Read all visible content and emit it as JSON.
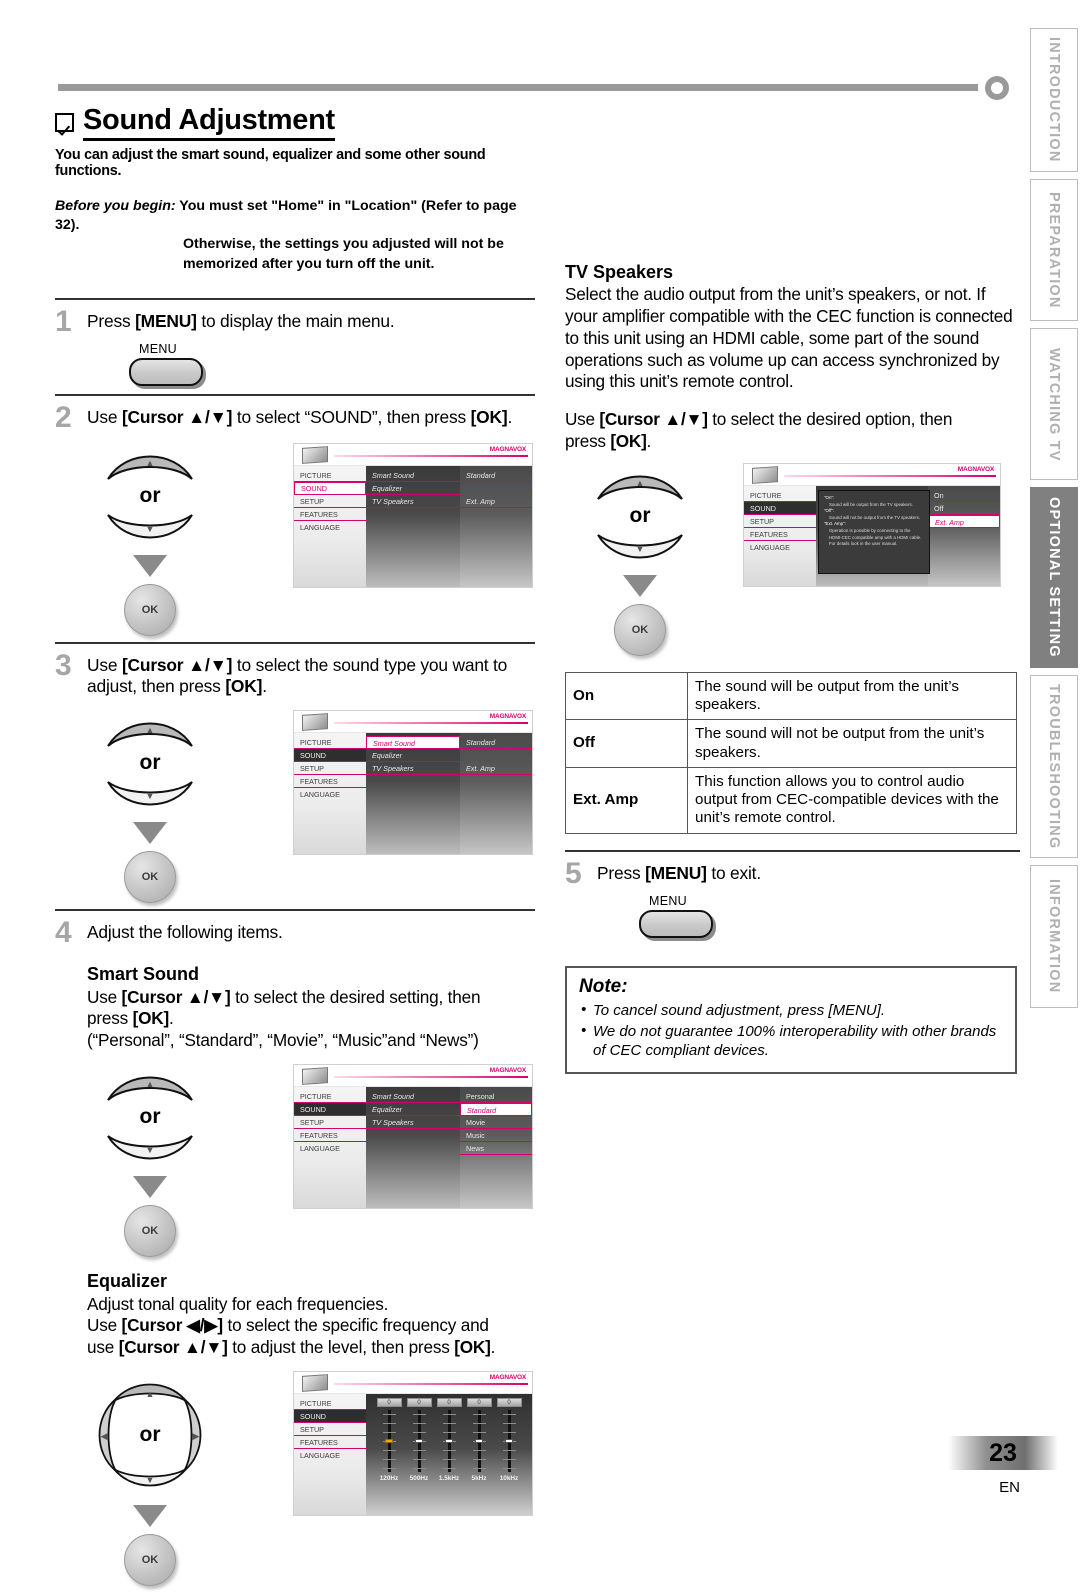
{
  "page": {
    "number": "23",
    "lang": "EN"
  },
  "tabs": [
    {
      "label": "INTRODUCTION",
      "active": false
    },
    {
      "label": "PREPARATION",
      "active": false
    },
    {
      "label": "WATCHING TV",
      "active": false
    },
    {
      "label": "OPTIONAL SETTING",
      "active": true
    },
    {
      "label": "TROUBLESHOOTING",
      "active": false
    },
    {
      "label": "INFORMATION",
      "active": false
    }
  ],
  "heading": {
    "title": "Sound Adjustment",
    "intro": "You can adjust the smart sound, equalizer and some other sound functions.",
    "before_label": "Before you begin:",
    "before_line1": "You must set \"Home\" in \"Location\" (Refer to page 32).",
    "before_line2": "Otherwise, the settings you adjusted will not be",
    "before_line3": "memorized after you turn off the unit."
  },
  "steps": {
    "s1": {
      "num": "1",
      "text_a": "Press ",
      "text_b": "[MENU]",
      "text_c": " to display the main menu.",
      "button_label": "MENU"
    },
    "s2": {
      "num": "2",
      "text_a": "Use ",
      "text_b": "[Cursor ▲/▼]",
      "text_c": " to select “SOUND”, then press ",
      "text_d": "[OK]",
      "text_e": "."
    },
    "s3": {
      "num": "3",
      "text_a": "Use ",
      "text_b": "[Cursor ▲/▼]",
      "text_c": " to select the sound type you want to",
      "line2_a": "adjust, then press ",
      "line2_b": "[OK]",
      "line2_c": "."
    },
    "s4": {
      "num": "4",
      "text": "Adjust the following items."
    },
    "s5": {
      "num": "5",
      "text_a": "Press ",
      "text_b": "[MENU]",
      "text_c": " to exit.",
      "button_label": "MENU"
    }
  },
  "smart_sound": {
    "heading": "Smart Sound",
    "line1_a": "Use ",
    "line1_b": "[Cursor ▲/▼]",
    "line1_c": " to select the desired setting, then",
    "line2_a": "press ",
    "line2_b": "[OK]",
    "line2_c": ".",
    "line3": "(“Personal”, “Standard”, “Movie”, “Music”and “News”)"
  },
  "equalizer": {
    "heading": "Equalizer",
    "line1": "Adjust tonal quality for each frequencies.",
    "line2_a": "Use ",
    "line2_b": "[Cursor ◀/▶]",
    "line2_c": " to select the specific frequency and",
    "line3_a": "use ",
    "line3_b": "[Cursor ▲/▼]",
    "line3_c": " to adjust the level, then press ",
    "line3_d": "[OK]",
    "line3_e": "."
  },
  "tv_speakers": {
    "heading": "TV Speakers",
    "body": "Select the audio output from the unit’s speakers, or not. If your amplifier compatible with the CEC function is connected to this unit using an HDMI cable, some part of the sound operations such as volume up can access synchronized by using this unit’s remote control.",
    "instr_a": "Use ",
    "instr_b": "[Cursor ▲/▼]",
    "instr_c": " to select the desired option, then",
    "instr_d": "press ",
    "instr_e": "[OK]",
    "instr_f": ".",
    "table": [
      {
        "key": "On",
        "desc": "The sound will be output from the unit’s speakers."
      },
      {
        "key": "Off",
        "desc": "The sound will not be output from the unit’s speakers."
      },
      {
        "key": "Ext. Amp",
        "desc": "This function allows you to control audio output from CEC-compatible devices with the unit’s remote control."
      }
    ]
  },
  "note": {
    "title": "Note:",
    "items": [
      "To cancel sound adjustment, press [MENU].",
      "We do not guarantee 100% interoperability with other brands of CEC compliant devices."
    ]
  },
  "osd": {
    "brand": "MAGNAVOX",
    "left_menu": [
      "PICTURE",
      "SOUND",
      "SETUP",
      "FEATURES",
      "LANGUAGE"
    ],
    "sound_items": [
      "Smart Sound",
      "Equalizer",
      "TV Speakers"
    ],
    "step2_values": [
      "Standard",
      "Ext. Amp"
    ],
    "step3_values": [
      "Standard",
      "Ext. Amp"
    ],
    "smart_sound_options": [
      "Personal",
      "Standard",
      "Movie",
      "Music",
      "News"
    ],
    "tv_speaker_options": [
      "On",
      "Off",
      "Ext. Amp"
    ],
    "tv_speaker_tip": {
      "on_key": "\"On\":",
      "on_text": "Sound will be output from the TV speakers.",
      "off_key": "\"Off\":",
      "off_text": "Sound will not be output from the TV speakers.",
      "ext_key": "\"Ext. Amp\":",
      "ext_text": "Operation is possible by connecting to the HDMI-CEC compatible amp with a HDMI cable. For details look in the user manual."
    },
    "equalizer": {
      "frequencies": [
        "120Hz",
        "500Hz",
        "1.5kHz",
        "5kHz",
        "10kHz"
      ],
      "values": [
        "0",
        "0",
        "0",
        "0",
        "0"
      ],
      "selected_index": 0
    }
  },
  "colors": {
    "accent": "#d9006e",
    "tab_active_bg": "#808080",
    "rule": "#9a9a9a"
  }
}
